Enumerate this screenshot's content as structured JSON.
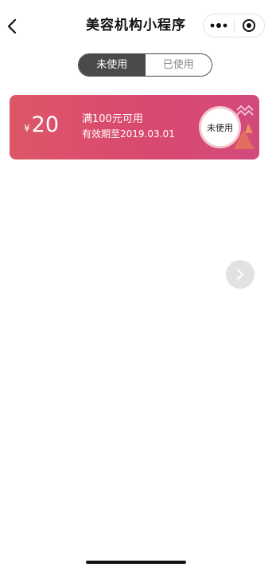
{
  "navbar": {
    "title": "美容机构小程序",
    "back_icon": "chevron-left-icon",
    "more_icon": "more-dots-icon",
    "close_icon": "target-circle-icon"
  },
  "tabs": [
    {
      "label": "未使用",
      "active": true
    },
    {
      "label": "已使用",
      "active": false
    }
  ],
  "coupon": {
    "currency": "¥",
    "amount": "20",
    "condition": "满100元可用",
    "expiry": "有效期至2019.03.01",
    "status": "未使用",
    "gradient_start": "#dd5668",
    "gradient_end": "#d24a7c"
  },
  "fab": {
    "icon": "chevron-right-icon"
  },
  "colors": {
    "accent": "#d9496f",
    "tab_active_bg": "#4a4a4a",
    "fab_bg": "#e2e2e2"
  }
}
